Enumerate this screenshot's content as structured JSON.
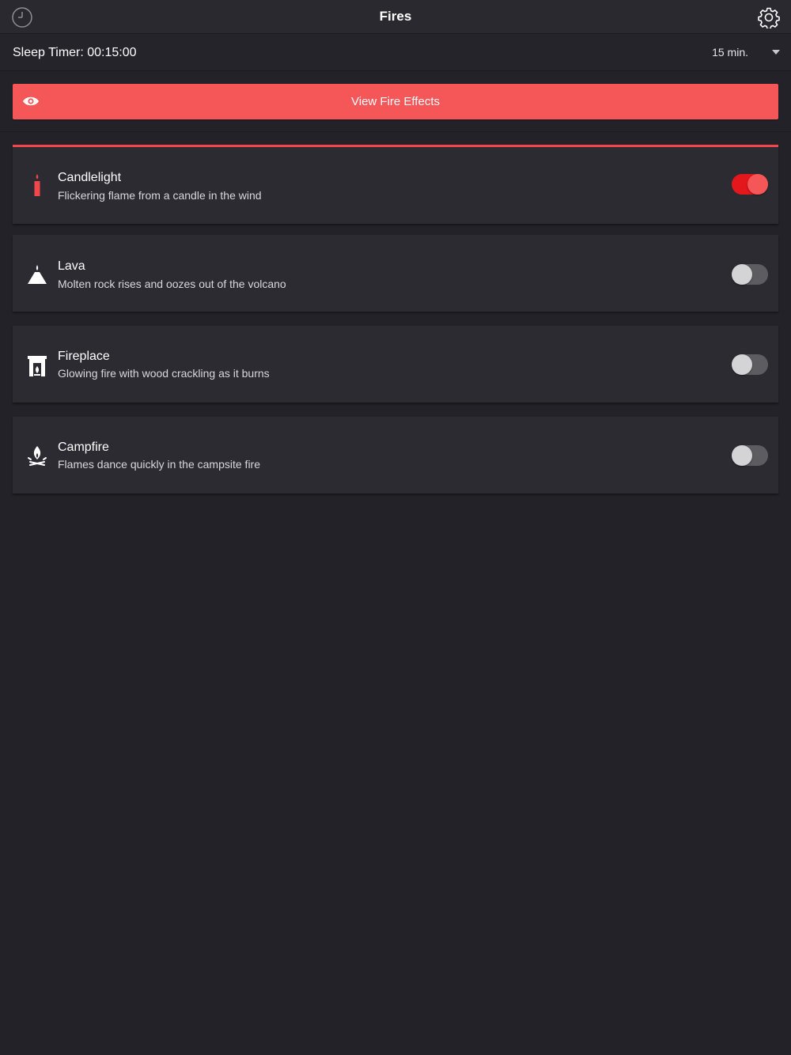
{
  "header": {
    "title": "Fires",
    "left_icon": "clock-icon",
    "right_icon": "gear-icon"
  },
  "sleep_timer": {
    "label": "Sleep Timer: 00:15:00",
    "selected": "15 min."
  },
  "view_button": {
    "label": "View Fire Effects",
    "icon": "eye-icon"
  },
  "colors": {
    "accent": "#f55657",
    "toggle_on": "#e4171c",
    "background": "#232228",
    "card": "#2c2b31"
  },
  "fires": [
    {
      "name": "Candlelight",
      "description": "Flickering flame from a candle in the wind",
      "icon": "candle-icon",
      "enabled": true
    },
    {
      "name": "Lava",
      "description": "Molten rock rises and oozes out of the volcano",
      "icon": "volcano-icon",
      "enabled": false
    },
    {
      "name": "Fireplace",
      "description": "Glowing fire with wood crackling as it burns",
      "icon": "fireplace-icon",
      "enabled": false
    },
    {
      "name": "Campfire",
      "description": "Flames dance quickly in the campsite fire",
      "icon": "campfire-icon",
      "enabled": false
    }
  ]
}
